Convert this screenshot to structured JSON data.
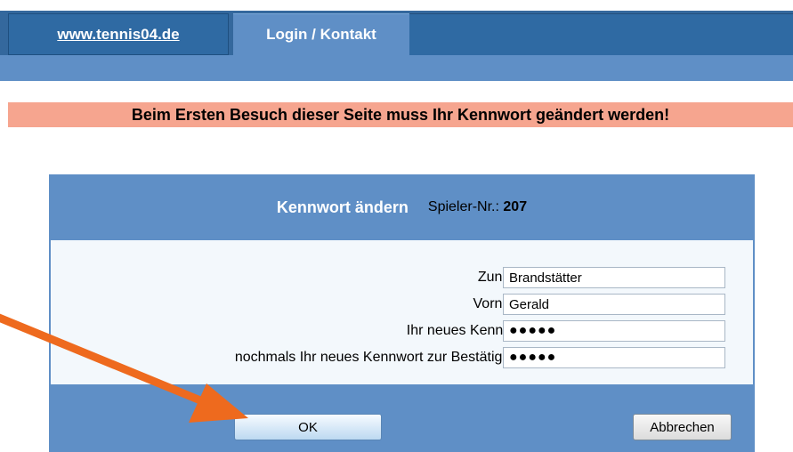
{
  "nav": {
    "tabs": [
      {
        "label": "www.tennis04.de"
      },
      {
        "label": "Login / Kontakt"
      }
    ]
  },
  "notice": {
    "text": "Beim Ersten Besuch dieser Seite muss Ihr Kennwort geändert werden!"
  },
  "panel": {
    "title": "Kennwort ändern",
    "spieler_label": "Spieler-Nr.:",
    "spieler_nr": "207",
    "fields": [
      {
        "label": "Zuname:",
        "value": "Brandstätter"
      },
      {
        "label": "Vorname:",
        "value": "Gerald"
      },
      {
        "label": "Ihr neues Kennwort:",
        "value": "●●●●●"
      },
      {
        "label": "nochmals Ihr neues Kennwort zur Bestätigung :",
        "value": "●●●●●"
      }
    ],
    "ok_label": "OK",
    "cancel_label": "Abbrechen"
  },
  "colors": {
    "nav_dark": "#2f6aa3",
    "nav_light": "#5f8fc6",
    "notice_bg": "#f6a58f",
    "arrow": "#ee6a1e"
  }
}
